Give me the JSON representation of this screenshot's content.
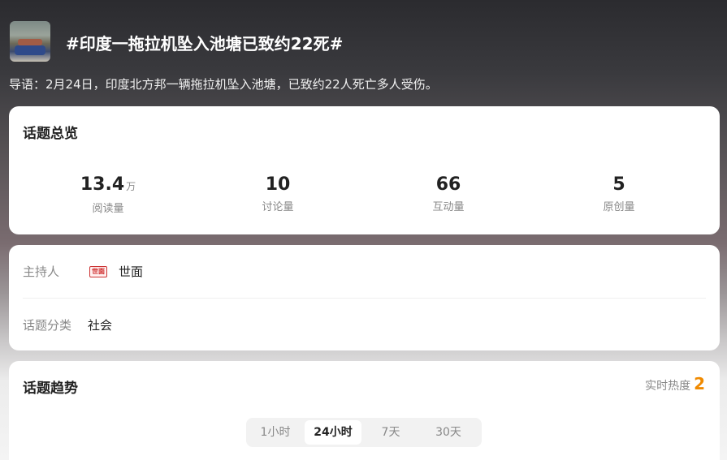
{
  "topic": {
    "title": "#印度一拖拉机坠入池塘已致约22死#",
    "lead": "导语：2月24日，印度北方邦一辆拖拉机坠入池塘，已致约22人死亡多人受伤。"
  },
  "overview": {
    "title": "话题总览",
    "stats": [
      {
        "value": "13.4",
        "unit": "万",
        "label": "阅读量"
      },
      {
        "value": "10",
        "unit": "",
        "label": "讨论量"
      },
      {
        "value": "66",
        "unit": "",
        "label": "互动量"
      },
      {
        "value": "5",
        "unit": "",
        "label": "原创量"
      }
    ]
  },
  "info": {
    "host_label": "主持人",
    "host_badge": "世面",
    "host_name": "世面",
    "category_label": "话题分类",
    "category_value": "社会"
  },
  "trend": {
    "title": "话题趋势",
    "heat_label": "实时热度",
    "heat_value": "2",
    "accent_color": "#f08a00",
    "tabs": [
      {
        "label": "1小时",
        "active": false
      },
      {
        "label": "24小时",
        "active": true
      },
      {
        "label": "7天",
        "active": false
      },
      {
        "label": "30天",
        "active": false
      }
    ]
  }
}
